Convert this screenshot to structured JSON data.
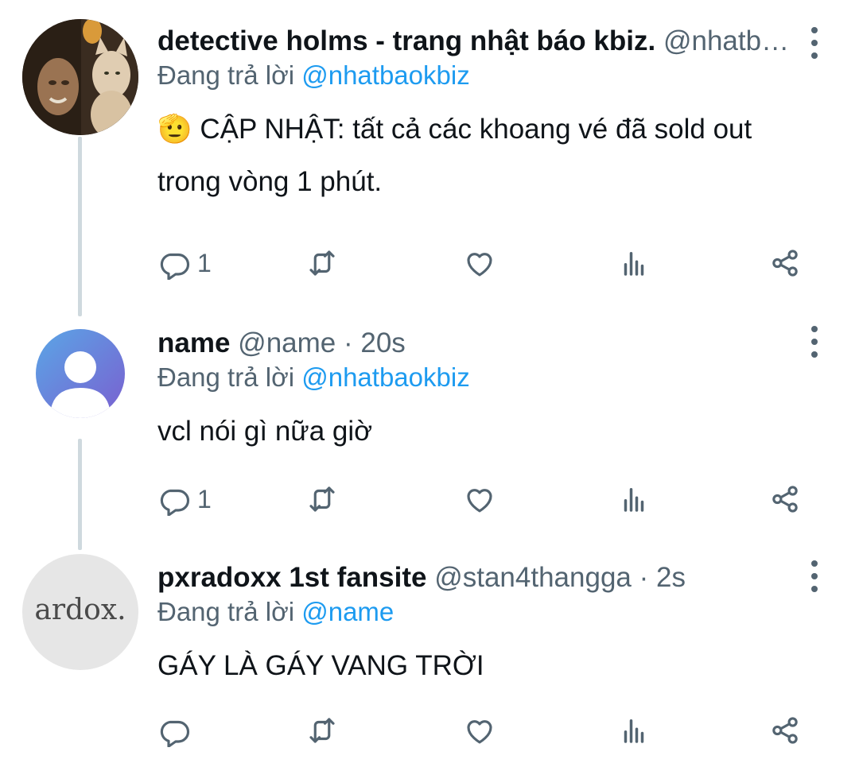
{
  "colors": {
    "text": "#0f1419",
    "muted": "#536471",
    "link": "#1d9bf0",
    "thread_line": "#cfd9de"
  },
  "tweets": [
    {
      "display_name": "detective holms - trang nhật báo kbiz.",
      "handle": "@nhatb…",
      "timestamp": "",
      "reply_prefix": "Đang trả lời",
      "reply_to": "@nhatbaokbiz",
      "text_emoji": "🫡",
      "text": "CẬP NHẬT: tất cả các khoang vé đã sold out trong vòng 1 phút.",
      "reply_count": "1",
      "avatar_icon": "photo-avatar"
    },
    {
      "display_name": "name",
      "handle": "@name",
      "timestamp": "· 20s",
      "reply_prefix": "Đang trả lời",
      "reply_to": "@nhatbaokbiz",
      "text_emoji": "",
      "text": "vcl nói gì nữa giờ",
      "reply_count": "1",
      "avatar_icon": "default-user-avatar"
    },
    {
      "display_name": "pxradoxx 1st fansite",
      "handle": "@stan4thangga",
      "timestamp": "· 2s",
      "reply_prefix": "Đang trả lời",
      "reply_to": "@name",
      "text_emoji": "",
      "text": "GÁY LÀ GÁY VANG TRỜI",
      "reply_count": "",
      "avatar_icon": "logo-avatar",
      "avatar_text": "ardox."
    }
  ]
}
